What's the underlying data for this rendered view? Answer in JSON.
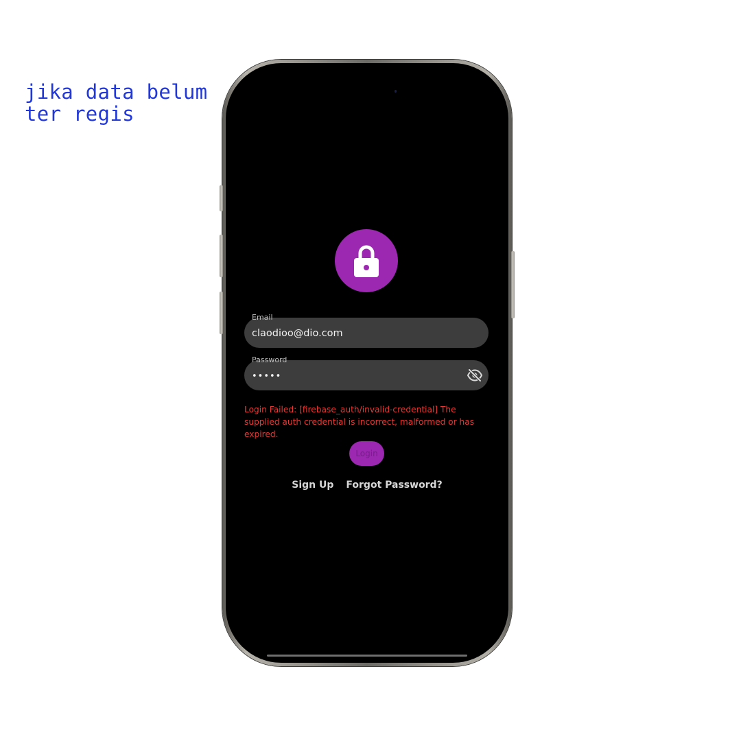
{
  "annotation": {
    "lines": [
      "jika data belum",
      "ter regis"
    ],
    "color": "#2238d6"
  },
  "app": {
    "accent_color": "#9c27b0",
    "error_color": "#e53935",
    "header_icon": "lock-icon",
    "email": {
      "label": "Email",
      "value": "claodioo@dio.com"
    },
    "password": {
      "label": "Password",
      "value": "•••••",
      "visibility_icon": "eye-off-icon"
    },
    "error_message": "Login Failed: [firebase_auth/invalid-credential] The supplied auth credential is incorrect, malformed or has expired.",
    "login_label": "Login",
    "signup_label": "Sign Up",
    "forgot_label": "Forgot Password?"
  }
}
